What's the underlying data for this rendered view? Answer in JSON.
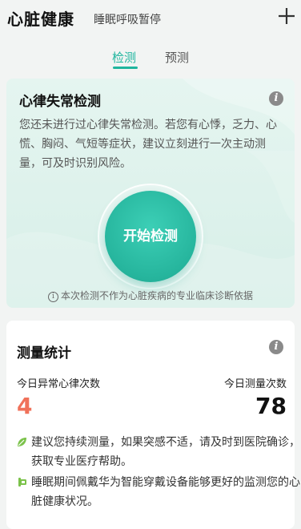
{
  "header": {
    "title": "心脏健康",
    "subtitle": "睡眠呼吸暂停",
    "add_icon": "plus-icon"
  },
  "tabs": [
    {
      "label": "检测",
      "active": true
    },
    {
      "label": "预测",
      "active": false
    }
  ],
  "arrhythmia_card": {
    "title": "心律失常检测",
    "description": "您还未进行过心律失常检测。若您有心悸，乏力、心慌、胸闷、气短等症状，建议立刻进行一次主动测量，可及时识别风险。",
    "start_button": "开始检测",
    "disclaimer": "本次检测不作为心脏疾病的专业临床诊断依据",
    "info_icon": "info-icon"
  },
  "stats_card": {
    "title": "测量统计",
    "left_label": "今日异常心律次数",
    "left_value": "4",
    "right_label": "今日测量次数",
    "right_value": "78",
    "tips": [
      {
        "icon": "leaf-icon",
        "text": "建议您持续测量，如果突感不适，请及时到医院确诊，获取专业医疗帮助。"
      },
      {
        "icon": "watch-icon",
        "text": "睡眠期间佩戴华为智能穿戴设备能够更好的监测您的心脏健康状况。"
      }
    ]
  },
  "colors": {
    "accent": "#1fb59e",
    "abnormal": "#f0715a",
    "card_bg": "#e5f5f0"
  }
}
